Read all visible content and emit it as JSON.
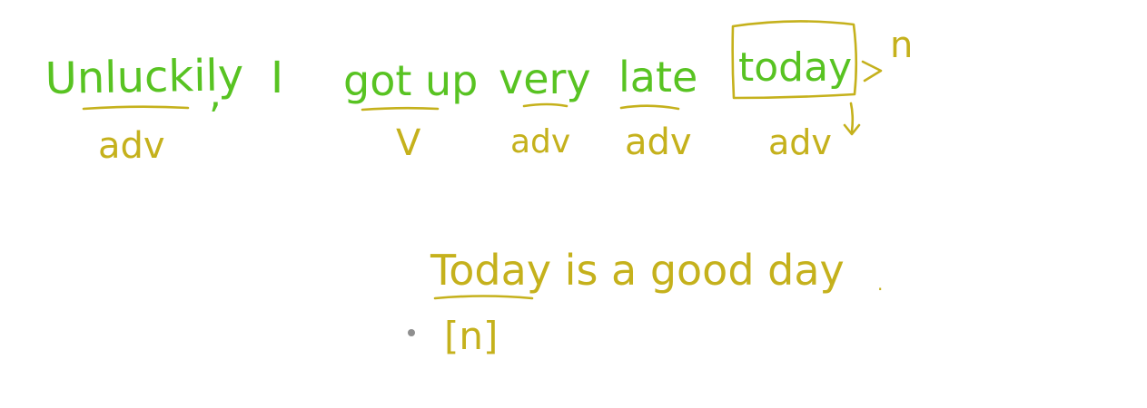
{
  "sentence_1": {
    "words": [
      "Unluckily",
      ",",
      "I",
      "got up",
      "very",
      "late",
      "today"
    ],
    "labels": [
      "adv",
      "V",
      "adv",
      "adv",
      "adv"
    ],
    "noun_mark": "n"
  },
  "sentence_2": {
    "text": "Today is a good day",
    "period": ".",
    "label": "[n]"
  },
  "colors": {
    "green_ink": "#58c322",
    "olive_ink": "#c5b11c",
    "background": "#ffffff",
    "cursor_dot": "#8f8f8f"
  }
}
